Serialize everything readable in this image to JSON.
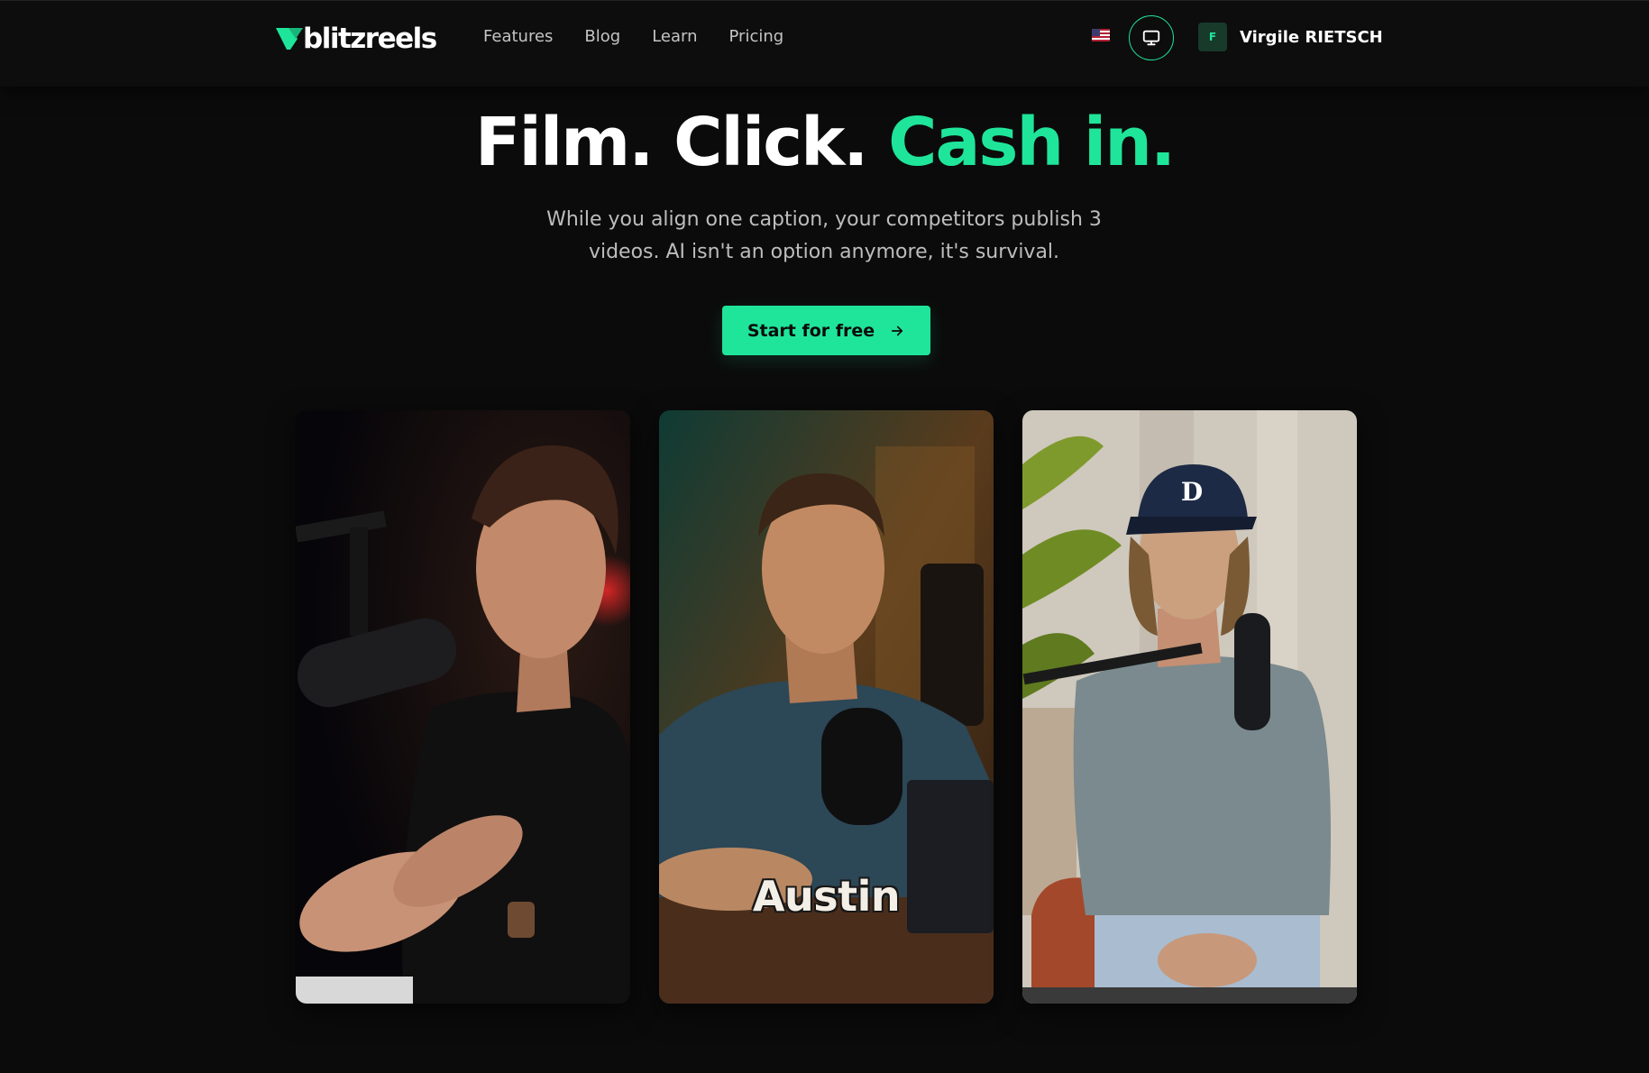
{
  "nav": {
    "logo": "blitzreels",
    "links": [
      "Features",
      "Blog",
      "Learn",
      "Pricing"
    ],
    "user": {
      "initial": "F",
      "name": "Virgile RIETSCH"
    }
  },
  "hero": {
    "title_part1": "Film. Click.",
    "title_part2": "Cash in.",
    "subtitle": "While you align one caption, your competitors publish 3 videos. AI isn't an option anymore, it's survival.",
    "cta_label": "Start for free"
  },
  "videos": [
    {
      "caption": ""
    },
    {
      "caption": "Austin"
    },
    {
      "caption": ""
    }
  ],
  "colors": {
    "accent": "#1fe59a",
    "background": "#0b0b0b",
    "navbar": "#0d0d0d"
  },
  "icons": [
    "logo-mark-icon",
    "us-flag-icon",
    "monitor-icon",
    "arrow-right-icon"
  ]
}
